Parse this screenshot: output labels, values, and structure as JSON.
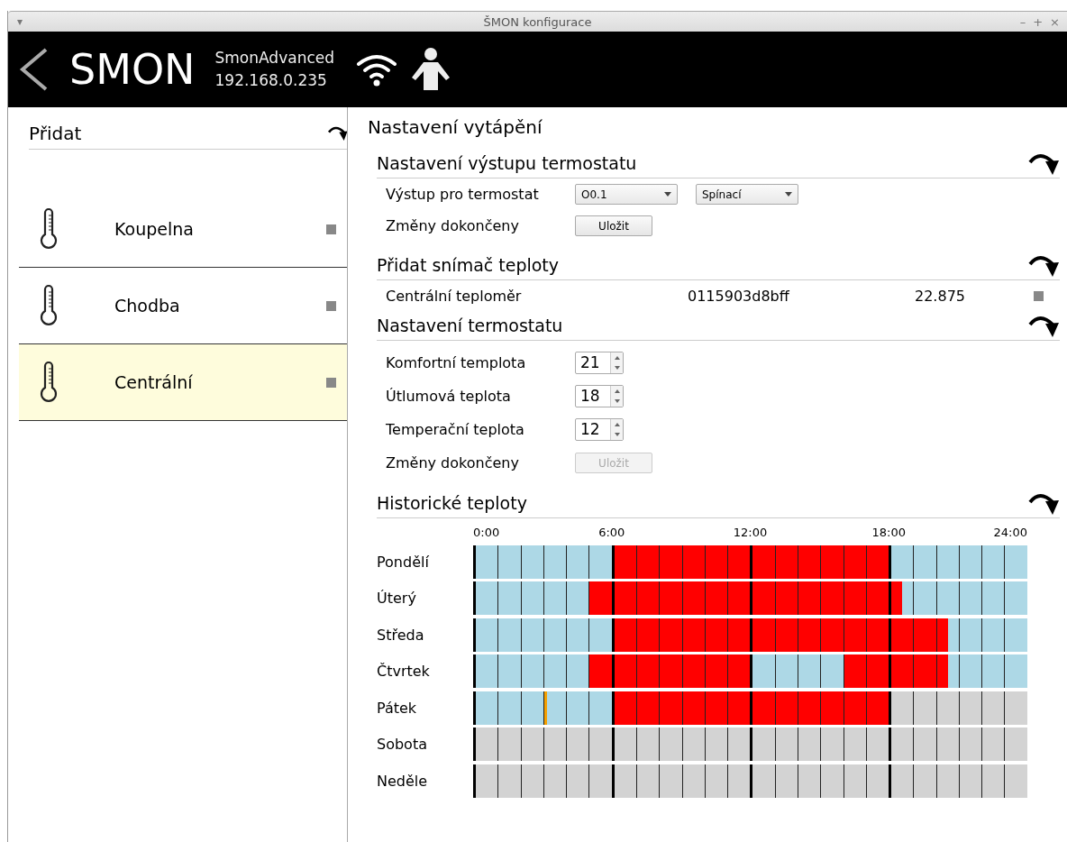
{
  "window": {
    "menu_glyph": "▾",
    "title": "ŠMON konfigurace",
    "controls": [
      "–",
      "+",
      "×"
    ]
  },
  "header": {
    "app_name": "SMON",
    "device_name": "SmonAdvanced",
    "ip": "192.168.0.235"
  },
  "sidebar": {
    "title": "Přidat",
    "items": [
      {
        "name": "Koupelna",
        "selected": false
      },
      {
        "name": "Chodba",
        "selected": false
      },
      {
        "name": "Centrální",
        "selected": true
      }
    ]
  },
  "main": {
    "title": "Nastavení vytápění",
    "output_section": {
      "title": "Nastavení výstupu termostatu",
      "output_label": "Výstup pro termostat",
      "selects": [
        "O0.1",
        "Spínací"
      ],
      "save_label": "Změny dokončeny",
      "save_button": {
        "label": "Uložit",
        "disabled": false
      }
    },
    "sensor_section": {
      "title": "Přidat snímač teploty",
      "sensors": [
        {
          "name": "Centrální teploměr",
          "id": "0115903d8bff",
          "value": "22.875"
        }
      ]
    },
    "thermostat_section": {
      "title": "Nastavení termostatu",
      "fields": [
        {
          "label": "Komfortní templota",
          "value": "21"
        },
        {
          "label": "Útlumová teplota",
          "value": "18"
        },
        {
          "label": "Temperační teplota",
          "value": "12"
        }
      ],
      "save_label": "Změny dokončeny",
      "save_button": {
        "label": "Uložit",
        "disabled": true
      }
    },
    "history": {
      "title": "Historické teploty",
      "hour_labels": [
        "0:00",
        "6:00",
        "12:00",
        "18:00",
        "24:00"
      ],
      "rows": [
        {
          "day": "Pondělí",
          "slots": [
            {
              "kind": "low"
            },
            {
              "kind": "low"
            },
            {
              "kind": "low"
            },
            {
              "kind": "low"
            },
            {
              "kind": "low"
            },
            {
              "kind": "low"
            },
            {
              "kind": "low"
            },
            {
              "kind": "low"
            },
            {
              "kind": "low"
            },
            {
              "kind": "low"
            },
            {
              "kind": "low"
            },
            {
              "kind": "low"
            },
            {
              "kind": "heat"
            },
            {
              "kind": "heat"
            },
            {
              "kind": "heat"
            },
            {
              "kind": "heat"
            },
            {
              "kind": "heat"
            },
            {
              "kind": "heat"
            },
            {
              "kind": "heat"
            },
            {
              "kind": "heat"
            },
            {
              "kind": "heat"
            },
            {
              "kind": "heat"
            },
            {
              "kind": "heat"
            },
            {
              "kind": "heat"
            },
            {
              "kind": "heat"
            },
            {
              "kind": "heat"
            },
            {
              "kind": "heat"
            },
            {
              "kind": "heat"
            },
            {
              "kind": "heat"
            },
            {
              "kind": "heat"
            },
            {
              "kind": "heat"
            },
            {
              "kind": "heat"
            },
            {
              "kind": "heat"
            },
            {
              "kind": "heat"
            },
            {
              "kind": "heat"
            },
            {
              "kind": "heat"
            },
            {
              "kind": "low"
            },
            {
              "kind": "low"
            },
            {
              "kind": "low"
            },
            {
              "kind": "low"
            },
            {
              "kind": "low"
            },
            {
              "kind": "low"
            },
            {
              "kind": "low"
            },
            {
              "kind": "low"
            },
            {
              "kind": "low"
            },
            {
              "kind": "low"
            },
            {
              "kind": "low"
            },
            {
              "kind": "low"
            }
          ]
        },
        {
          "day": "Úterý",
          "slots": [
            {
              "kind": "low"
            },
            {
              "kind": "low"
            },
            {
              "kind": "low"
            },
            {
              "kind": "low"
            },
            {
              "kind": "low"
            },
            {
              "kind": "low"
            },
            {
              "kind": "low"
            },
            {
              "kind": "low"
            },
            {
              "kind": "low"
            },
            {
              "kind": "low"
            },
            {
              "kind": "heat"
            },
            {
              "kind": "heat"
            },
            {
              "kind": "heat"
            },
            {
              "kind": "heat"
            },
            {
              "kind": "heat"
            },
            {
              "kind": "heat"
            },
            {
              "kind": "heat"
            },
            {
              "kind": "heat"
            },
            {
              "kind": "heat"
            },
            {
              "kind": "heat"
            },
            {
              "kind": "heat"
            },
            {
              "kind": "heat"
            },
            {
              "kind": "heat"
            },
            {
              "kind": "heat"
            },
            {
              "kind": "heat"
            },
            {
              "kind": "heat"
            },
            {
              "kind": "heat"
            },
            {
              "kind": "heat"
            },
            {
              "kind": "heat"
            },
            {
              "kind": "heat"
            },
            {
              "kind": "heat"
            },
            {
              "kind": "heat"
            },
            {
              "kind": "heat"
            },
            {
              "kind": "heat"
            },
            {
              "kind": "heat"
            },
            {
              "kind": "heat"
            },
            {
              "kind": "heat"
            },
            {
              "kind": "low"
            },
            {
              "kind": "low"
            },
            {
              "kind": "low"
            },
            {
              "kind": "low"
            },
            {
              "kind": "low"
            },
            {
              "kind": "low"
            },
            {
              "kind": "low"
            },
            {
              "kind": "low"
            },
            {
              "kind": "low"
            },
            {
              "kind": "low"
            },
            {
              "kind": "low"
            }
          ]
        },
        {
          "day": "Středa",
          "slots": [
            {
              "kind": "low"
            },
            {
              "kind": "low"
            },
            {
              "kind": "low"
            },
            {
              "kind": "low"
            },
            {
              "kind": "low"
            },
            {
              "kind": "low"
            },
            {
              "kind": "low"
            },
            {
              "kind": "low"
            },
            {
              "kind": "low"
            },
            {
              "kind": "low"
            },
            {
              "kind": "low"
            },
            {
              "kind": "low"
            },
            {
              "kind": "heat"
            },
            {
              "kind": "heat"
            },
            {
              "kind": "heat"
            },
            {
              "kind": "heat"
            },
            {
              "kind": "heat"
            },
            {
              "kind": "heat"
            },
            {
              "kind": "heat"
            },
            {
              "kind": "heat"
            },
            {
              "kind": "heat"
            },
            {
              "kind": "heat"
            },
            {
              "kind": "heat"
            },
            {
              "kind": "heat"
            },
            {
              "kind": "heat"
            },
            {
              "kind": "heat"
            },
            {
              "kind": "heat"
            },
            {
              "kind": "heat"
            },
            {
              "kind": "heat"
            },
            {
              "kind": "heat"
            },
            {
              "kind": "heat"
            },
            {
              "kind": "heat"
            },
            {
              "kind": "heat"
            },
            {
              "kind": "heat"
            },
            {
              "kind": "heat"
            },
            {
              "kind": "heat"
            },
            {
              "kind": "heat"
            },
            {
              "kind": "heat"
            },
            {
              "kind": "heat"
            },
            {
              "kind": "heat"
            },
            {
              "kind": "heat"
            },
            {
              "kind": "low"
            },
            {
              "kind": "low"
            },
            {
              "kind": "low"
            },
            {
              "kind": "low"
            },
            {
              "kind": "low"
            },
            {
              "kind": "low"
            },
            {
              "kind": "low"
            }
          ]
        },
        {
          "day": "Čtvrtek",
          "slots": [
            {
              "kind": "low"
            },
            {
              "kind": "low"
            },
            {
              "kind": "low"
            },
            {
              "kind": "low"
            },
            {
              "kind": "low"
            },
            {
              "kind": "low"
            },
            {
              "kind": "low"
            },
            {
              "kind": "low"
            },
            {
              "kind": "low"
            },
            {
              "kind": "low"
            },
            {
              "kind": "heat"
            },
            {
              "kind": "heat"
            },
            {
              "kind": "heat"
            },
            {
              "kind": "heat"
            },
            {
              "kind": "heat"
            },
            {
              "kind": "heat"
            },
            {
              "kind": "heat"
            },
            {
              "kind": "heat"
            },
            {
              "kind": "heat"
            },
            {
              "kind": "heat"
            },
            {
              "kind": "heat"
            },
            {
              "kind": "heat"
            },
            {
              "kind": "heat"
            },
            {
              "kind": "heat"
            },
            {
              "kind": "low"
            },
            {
              "kind": "low"
            },
            {
              "kind": "low"
            },
            {
              "kind": "low"
            },
            {
              "kind": "low"
            },
            {
              "kind": "low"
            },
            {
              "kind": "low"
            },
            {
              "kind": "low"
            },
            {
              "kind": "heat"
            },
            {
              "kind": "heat"
            },
            {
              "kind": "heat"
            },
            {
              "kind": "heat"
            },
            {
              "kind": "heat"
            },
            {
              "kind": "heat"
            },
            {
              "kind": "heat"
            },
            {
              "kind": "heat"
            },
            {
              "kind": "heat"
            },
            {
              "kind": "low"
            },
            {
              "kind": "low"
            },
            {
              "kind": "low"
            },
            {
              "kind": "low"
            },
            {
              "kind": "low"
            },
            {
              "kind": "low"
            },
            {
              "kind": "low"
            }
          ]
        },
        {
          "day": "Pátek",
          "slots": [
            {
              "kind": "low"
            },
            {
              "kind": "low"
            },
            {
              "kind": "low"
            },
            {
              "kind": "low"
            },
            {
              "kind": "low"
            },
            {
              "kind": "low"
            },
            {
              "kind": "mark"
            },
            {
              "kind": "low"
            },
            {
              "kind": "low"
            },
            {
              "kind": "low"
            },
            {
              "kind": "low"
            },
            {
              "kind": "low"
            },
            {
              "kind": "heat"
            },
            {
              "kind": "heat"
            },
            {
              "kind": "heat"
            },
            {
              "kind": "heat"
            },
            {
              "kind": "heat"
            },
            {
              "kind": "heat"
            },
            {
              "kind": "heat"
            },
            {
              "kind": "heat"
            },
            {
              "kind": "heat"
            },
            {
              "kind": "heat"
            },
            {
              "kind": "heat"
            },
            {
              "kind": "heat"
            },
            {
              "kind": "heat"
            },
            {
              "kind": "heat"
            },
            {
              "kind": "heat"
            },
            {
              "kind": "heat"
            },
            {
              "kind": "heat"
            },
            {
              "kind": "heat"
            },
            {
              "kind": "heat"
            },
            {
              "kind": "heat"
            },
            {
              "kind": "heat"
            },
            {
              "kind": "heat"
            },
            {
              "kind": "heat"
            },
            {
              "kind": "heat"
            },
            {
              "kind": "none"
            },
            {
              "kind": "none"
            },
            {
              "kind": "none"
            },
            {
              "kind": "none"
            },
            {
              "kind": "none"
            },
            {
              "kind": "none"
            },
            {
              "kind": "none"
            },
            {
              "kind": "none"
            },
            {
              "kind": "none"
            },
            {
              "kind": "none"
            },
            {
              "kind": "none"
            },
            {
              "kind": "none"
            }
          ]
        },
        {
          "day": "Sobota",
          "slots": [
            {
              "kind": "none"
            },
            {
              "kind": "none"
            },
            {
              "kind": "none"
            },
            {
              "kind": "none"
            },
            {
              "kind": "none"
            },
            {
              "kind": "none"
            },
            {
              "kind": "none"
            },
            {
              "kind": "none"
            },
            {
              "kind": "none"
            },
            {
              "kind": "none"
            },
            {
              "kind": "none"
            },
            {
              "kind": "none"
            },
            {
              "kind": "none"
            },
            {
              "kind": "none"
            },
            {
              "kind": "none"
            },
            {
              "kind": "none"
            },
            {
              "kind": "none"
            },
            {
              "kind": "none"
            },
            {
              "kind": "none"
            },
            {
              "kind": "none"
            },
            {
              "kind": "none"
            },
            {
              "kind": "none"
            },
            {
              "kind": "none"
            },
            {
              "kind": "none"
            },
            {
              "kind": "none"
            },
            {
              "kind": "none"
            },
            {
              "kind": "none"
            },
            {
              "kind": "none"
            },
            {
              "kind": "none"
            },
            {
              "kind": "none"
            },
            {
              "kind": "none"
            },
            {
              "kind": "none"
            },
            {
              "kind": "none"
            },
            {
              "kind": "none"
            },
            {
              "kind": "none"
            },
            {
              "kind": "none"
            },
            {
              "kind": "none"
            },
            {
              "kind": "none"
            },
            {
              "kind": "none"
            },
            {
              "kind": "none"
            },
            {
              "kind": "none"
            },
            {
              "kind": "none"
            },
            {
              "kind": "none"
            },
            {
              "kind": "none"
            },
            {
              "kind": "none"
            },
            {
              "kind": "none"
            },
            {
              "kind": "none"
            },
            {
              "kind": "none"
            }
          ]
        },
        {
          "day": "Neděle",
          "slots": [
            {
              "kind": "none"
            },
            {
              "kind": "none"
            },
            {
              "kind": "none"
            },
            {
              "kind": "none"
            },
            {
              "kind": "none"
            },
            {
              "kind": "none"
            },
            {
              "kind": "none"
            },
            {
              "kind": "none"
            },
            {
              "kind": "none"
            },
            {
              "kind": "none"
            },
            {
              "kind": "none"
            },
            {
              "kind": "none"
            },
            {
              "kind": "none"
            },
            {
              "kind": "none"
            },
            {
              "kind": "none"
            },
            {
              "kind": "none"
            },
            {
              "kind": "none"
            },
            {
              "kind": "none"
            },
            {
              "kind": "none"
            },
            {
              "kind": "none"
            },
            {
              "kind": "none"
            },
            {
              "kind": "none"
            },
            {
              "kind": "none"
            },
            {
              "kind": "none"
            },
            {
              "kind": "none"
            },
            {
              "kind": "none"
            },
            {
              "kind": "none"
            },
            {
              "kind": "none"
            },
            {
              "kind": "none"
            },
            {
              "kind": "none"
            },
            {
              "kind": "none"
            },
            {
              "kind": "none"
            },
            {
              "kind": "none"
            },
            {
              "kind": "none"
            },
            {
              "kind": "none"
            },
            {
              "kind": "none"
            },
            {
              "kind": "none"
            },
            {
              "kind": "none"
            },
            {
              "kind": "none"
            },
            {
              "kind": "none"
            },
            {
              "kind": "none"
            },
            {
              "kind": "none"
            },
            {
              "kind": "none"
            },
            {
              "kind": "none"
            },
            {
              "kind": "none"
            },
            {
              "kind": "none"
            },
            {
              "kind": "none"
            },
            {
              "kind": "none"
            }
          ]
        }
      ]
    }
  }
}
